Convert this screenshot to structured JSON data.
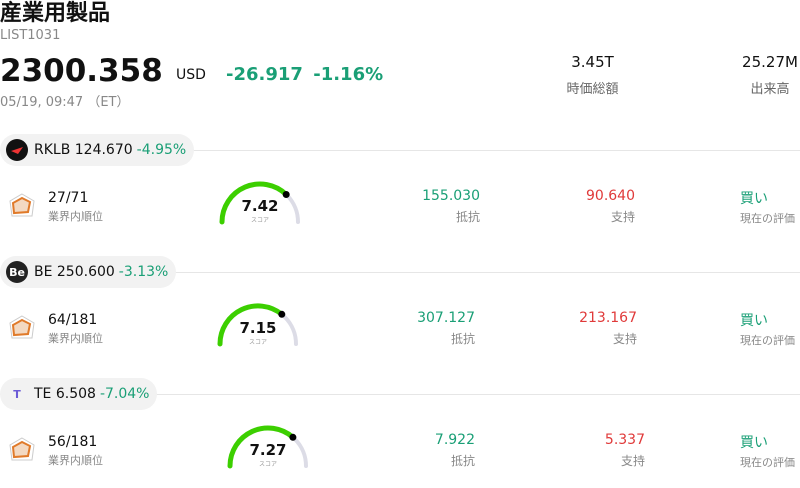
{
  "header": {
    "title": "産業用製品",
    "code": "LIST1031",
    "price": "2300.358",
    "currency": "USD",
    "change": "-26.917",
    "change_pct": "-1.16%",
    "time": "05/19, 09:47 （ET）"
  },
  "stats": [
    {
      "value": "3.45T",
      "label": "時価総額"
    },
    {
      "value": "25.27M",
      "label": "出来高"
    }
  ],
  "stocks": [
    {
      "symbol": "RKLB",
      "price": "124.670",
      "change_pct": "-4.95%",
      "logo_text": "",
      "rank": "27/71",
      "rank_label": "業界内順位",
      "score": "7.42",
      "score_label": "スコア",
      "score_fraction": 0.742,
      "resistance": "155.030",
      "resistance_label": "抵抗",
      "support": "90.640",
      "support_label": "支持",
      "rating": "買い",
      "rating_label": "現在の評価"
    },
    {
      "symbol": "BE",
      "price": "250.600",
      "change_pct": "-3.13%",
      "logo_text": "Be",
      "rank": "64/181",
      "rank_label": "業界内順位",
      "score": "7.15",
      "score_label": "スコア",
      "score_fraction": 0.715,
      "resistance": "307.127",
      "resistance_label": "抵抗",
      "support": "213.167",
      "support_label": "支持",
      "rating": "買い",
      "rating_label": "現在の評価"
    },
    {
      "symbol": "TE",
      "price": "6.508",
      "change_pct": "-7.04%",
      "logo_text": "T",
      "rank": "56/181",
      "rank_label": "業界内順位",
      "score": "7.27",
      "score_label": "スコア",
      "score_fraction": 0.727,
      "resistance": "7.922",
      "resistance_label": "抵抗",
      "support": "5.337",
      "support_label": "支持",
      "rating": "買い",
      "rating_label": "現在の評価"
    }
  ],
  "colors": {
    "positive": "#1a9f76",
    "negative": "#e03a3a",
    "gauge": "#3ccf00",
    "gauge_track": "#dcdce6"
  }
}
